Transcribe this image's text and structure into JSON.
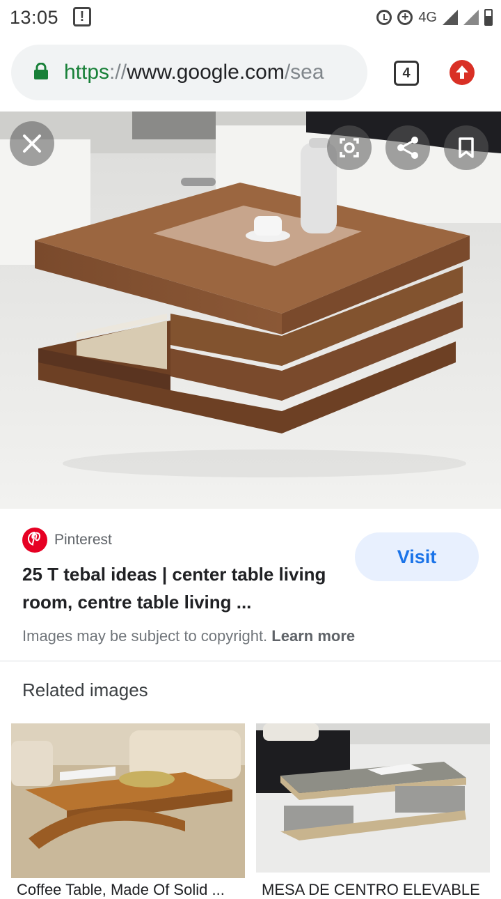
{
  "status_bar": {
    "time": "13:05",
    "alert_glyph": "!",
    "network": "4G",
    "icons": [
      "alert-icon",
      "alarm-icon",
      "data-saver-icon",
      "signal-icon",
      "battery-icon"
    ]
  },
  "browser": {
    "url_scheme": "https",
    "url_sep": "://",
    "url_host": "www.google.com",
    "url_path": "/sea",
    "tab_count": "4",
    "colors": {
      "secure": "#188038",
      "update": "#d93025"
    }
  },
  "viewer": {
    "image_alt": "Wooden square coffee table with glass center",
    "actions": [
      "close-icon",
      "lens-icon",
      "share-icon",
      "bookmark-icon"
    ]
  },
  "result": {
    "source": "Pinterest",
    "title": "25 T tebal ideas | center table living room, centre table living ...",
    "visit_label": "Visit",
    "copyright_text": "Images may be subject to copyright.",
    "learn_more": "Learn more",
    "colors": {
      "pinterest": "#e60023",
      "visit_text": "#1a73e8",
      "visit_bg": "#e8f0fe"
    }
  },
  "related": {
    "heading": "Related images",
    "items": [
      {
        "caption": "Coffee Table, Made Of Solid ..."
      },
      {
        "caption": "MESA DE CENTRO ELEVABLE ..."
      }
    ]
  }
}
